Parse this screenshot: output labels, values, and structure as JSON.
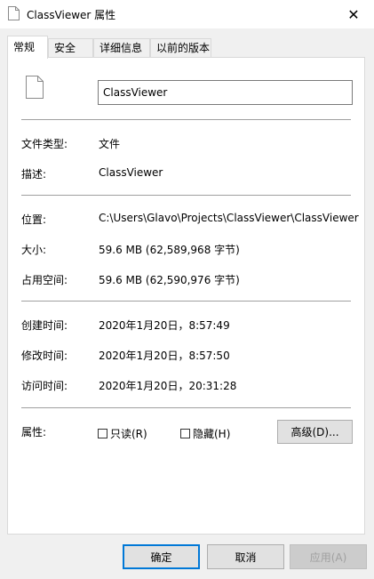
{
  "window": {
    "title": "ClassViewer 属性",
    "close_glyph": "✕"
  },
  "tabs": [
    {
      "label": "常规",
      "active": true
    },
    {
      "label": "安全"
    },
    {
      "label": "详细信息"
    },
    {
      "label": "以前的版本"
    }
  ],
  "general": {
    "name": "ClassViewer",
    "file_type_label": "文件类型:",
    "file_type_value": "文件",
    "description_label": "描述:",
    "description_value": "ClassViewer",
    "location_label": "位置:",
    "location_value": "C:\\Users\\Glavo\\Projects\\ClassViewer\\ClassViewer",
    "size_label": "大小:",
    "size_value": "59.6 MB (62,589,968 字节)",
    "size_on_disk_label": "占用空间:",
    "size_on_disk_value": "59.6 MB (62,590,976 字节)",
    "created_label": "创建时间:",
    "created_value": "2020年1月20日，8:57:49",
    "modified_label": "修改时间:",
    "modified_value": "2020年1月20日，8:57:50",
    "accessed_label": "访问时间:",
    "accessed_value": "2020年1月20日，20:31:28",
    "attributes_label": "属性:",
    "readonly_label": "只读(R)",
    "hidden_label": "隐藏(H)",
    "advanced_label": "高级(D)..."
  },
  "footer": {
    "ok": "确定",
    "cancel": "取消",
    "apply": "应用(A)"
  }
}
